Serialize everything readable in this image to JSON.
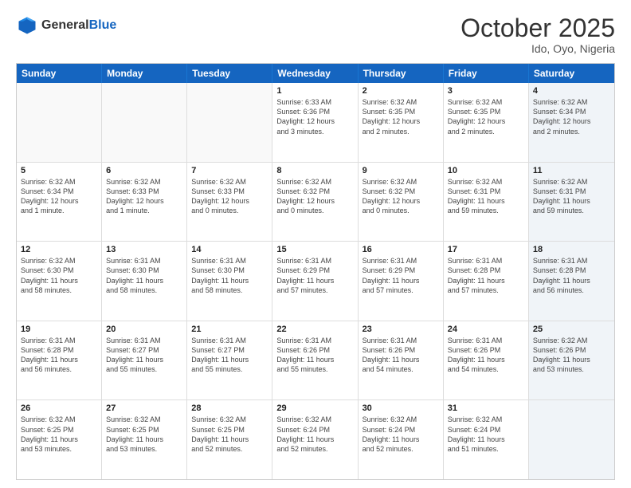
{
  "header": {
    "logo_line1": "General",
    "logo_line2": "Blue",
    "month": "October 2025",
    "location": "Ido, Oyo, Nigeria"
  },
  "weekdays": [
    "Sunday",
    "Monday",
    "Tuesday",
    "Wednesday",
    "Thursday",
    "Friday",
    "Saturday"
  ],
  "rows": [
    [
      {
        "day": "",
        "text": "",
        "empty": true
      },
      {
        "day": "",
        "text": "",
        "empty": true
      },
      {
        "day": "",
        "text": "",
        "empty": true
      },
      {
        "day": "1",
        "text": "Sunrise: 6:33 AM\nSunset: 6:36 PM\nDaylight: 12 hours\nand 3 minutes."
      },
      {
        "day": "2",
        "text": "Sunrise: 6:32 AM\nSunset: 6:35 PM\nDaylight: 12 hours\nand 2 minutes."
      },
      {
        "day": "3",
        "text": "Sunrise: 6:32 AM\nSunset: 6:35 PM\nDaylight: 12 hours\nand 2 minutes."
      },
      {
        "day": "4",
        "text": "Sunrise: 6:32 AM\nSunset: 6:34 PM\nDaylight: 12 hours\nand 2 minutes.",
        "shaded": true
      }
    ],
    [
      {
        "day": "5",
        "text": "Sunrise: 6:32 AM\nSunset: 6:34 PM\nDaylight: 12 hours\nand 1 minute."
      },
      {
        "day": "6",
        "text": "Sunrise: 6:32 AM\nSunset: 6:33 PM\nDaylight: 12 hours\nand 1 minute."
      },
      {
        "day": "7",
        "text": "Sunrise: 6:32 AM\nSunset: 6:33 PM\nDaylight: 12 hours\nand 0 minutes."
      },
      {
        "day": "8",
        "text": "Sunrise: 6:32 AM\nSunset: 6:32 PM\nDaylight: 12 hours\nand 0 minutes."
      },
      {
        "day": "9",
        "text": "Sunrise: 6:32 AM\nSunset: 6:32 PM\nDaylight: 12 hours\nand 0 minutes."
      },
      {
        "day": "10",
        "text": "Sunrise: 6:32 AM\nSunset: 6:31 PM\nDaylight: 11 hours\nand 59 minutes."
      },
      {
        "day": "11",
        "text": "Sunrise: 6:32 AM\nSunset: 6:31 PM\nDaylight: 11 hours\nand 59 minutes.",
        "shaded": true
      }
    ],
    [
      {
        "day": "12",
        "text": "Sunrise: 6:32 AM\nSunset: 6:30 PM\nDaylight: 11 hours\nand 58 minutes."
      },
      {
        "day": "13",
        "text": "Sunrise: 6:31 AM\nSunset: 6:30 PM\nDaylight: 11 hours\nand 58 minutes."
      },
      {
        "day": "14",
        "text": "Sunrise: 6:31 AM\nSunset: 6:30 PM\nDaylight: 11 hours\nand 58 minutes."
      },
      {
        "day": "15",
        "text": "Sunrise: 6:31 AM\nSunset: 6:29 PM\nDaylight: 11 hours\nand 57 minutes."
      },
      {
        "day": "16",
        "text": "Sunrise: 6:31 AM\nSunset: 6:29 PM\nDaylight: 11 hours\nand 57 minutes."
      },
      {
        "day": "17",
        "text": "Sunrise: 6:31 AM\nSunset: 6:28 PM\nDaylight: 11 hours\nand 57 minutes."
      },
      {
        "day": "18",
        "text": "Sunrise: 6:31 AM\nSunset: 6:28 PM\nDaylight: 11 hours\nand 56 minutes.",
        "shaded": true
      }
    ],
    [
      {
        "day": "19",
        "text": "Sunrise: 6:31 AM\nSunset: 6:28 PM\nDaylight: 11 hours\nand 56 minutes."
      },
      {
        "day": "20",
        "text": "Sunrise: 6:31 AM\nSunset: 6:27 PM\nDaylight: 11 hours\nand 55 minutes."
      },
      {
        "day": "21",
        "text": "Sunrise: 6:31 AM\nSunset: 6:27 PM\nDaylight: 11 hours\nand 55 minutes."
      },
      {
        "day": "22",
        "text": "Sunrise: 6:31 AM\nSunset: 6:26 PM\nDaylight: 11 hours\nand 55 minutes."
      },
      {
        "day": "23",
        "text": "Sunrise: 6:31 AM\nSunset: 6:26 PM\nDaylight: 11 hours\nand 54 minutes."
      },
      {
        "day": "24",
        "text": "Sunrise: 6:31 AM\nSunset: 6:26 PM\nDaylight: 11 hours\nand 54 minutes."
      },
      {
        "day": "25",
        "text": "Sunrise: 6:32 AM\nSunset: 6:26 PM\nDaylight: 11 hours\nand 53 minutes.",
        "shaded": true
      }
    ],
    [
      {
        "day": "26",
        "text": "Sunrise: 6:32 AM\nSunset: 6:25 PM\nDaylight: 11 hours\nand 53 minutes."
      },
      {
        "day": "27",
        "text": "Sunrise: 6:32 AM\nSunset: 6:25 PM\nDaylight: 11 hours\nand 53 minutes."
      },
      {
        "day": "28",
        "text": "Sunrise: 6:32 AM\nSunset: 6:25 PM\nDaylight: 11 hours\nand 52 minutes."
      },
      {
        "day": "29",
        "text": "Sunrise: 6:32 AM\nSunset: 6:24 PM\nDaylight: 11 hours\nand 52 minutes."
      },
      {
        "day": "30",
        "text": "Sunrise: 6:32 AM\nSunset: 6:24 PM\nDaylight: 11 hours\nand 52 minutes."
      },
      {
        "day": "31",
        "text": "Sunrise: 6:32 AM\nSunset: 6:24 PM\nDaylight: 11 hours\nand 51 minutes."
      },
      {
        "day": "",
        "text": "",
        "empty": true,
        "shaded": true
      }
    ]
  ]
}
